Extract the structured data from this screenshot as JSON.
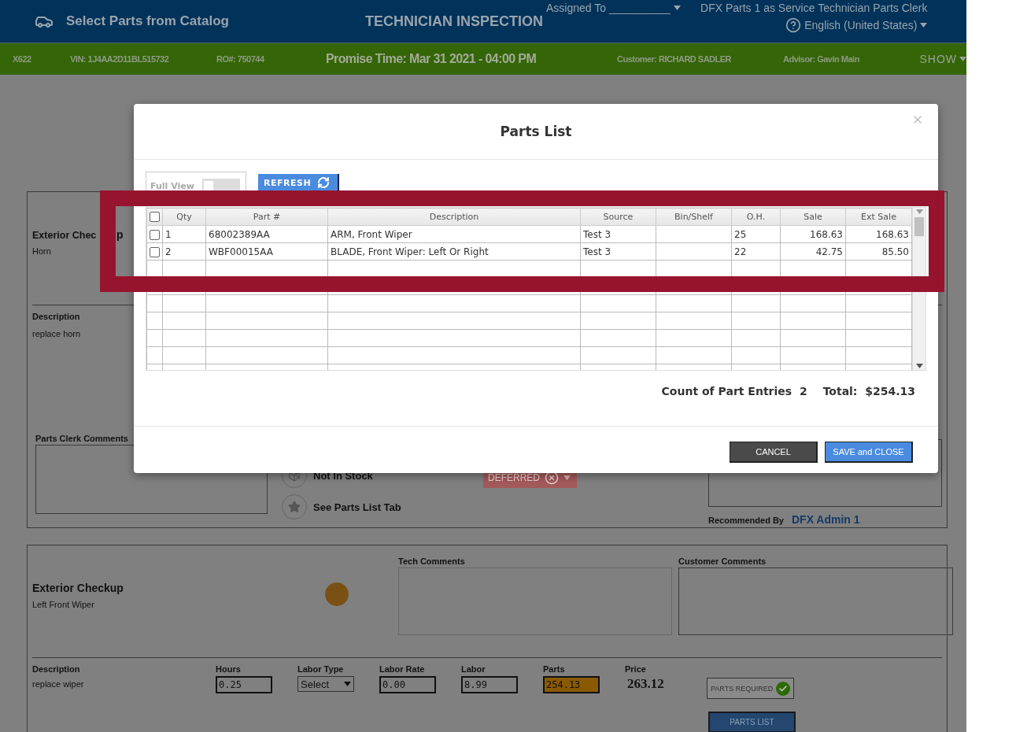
{
  "header": {
    "title": "Select Parts from Catalog",
    "page_title": "TECHNICIAN INSPECTION",
    "assigned_label": "Assigned To",
    "assigned_value": "__________",
    "user": "DFX Parts 1 as Service Technician Parts Clerk",
    "language": "English (United States)"
  },
  "vehicle_bar": {
    "unit": "X622",
    "vin": "VIN: 1J4AA2D11BL515732",
    "ro": "RO#: 750744",
    "promise_time": "Promise Time: Mar 31 2021 - 04:00 PM",
    "customer": "Customer: RICHARD SADLER",
    "advisor": "Advisor: Gavin Main",
    "show_button": "SHOW"
  },
  "inspection_items": [
    {
      "kind": "deferred",
      "category": "Exterior Chec",
      "category_tail": "p",
      "item": "Horn",
      "description_label": "Description",
      "description": "replace horn",
      "clerk_comments_label": "Parts Clerk Comments",
      "options": [
        {
          "kind": "not-in-stock",
          "label": "Not In Stock"
        },
        {
          "kind": "star",
          "label": "See Parts List Tab"
        }
      ],
      "status": "DEFERRED",
      "recommended_by_label": "Recommended By",
      "recommended_by": "DFX Admin 1"
    },
    {
      "kind": "detail",
      "category": "Exterior Checkup",
      "item": "Left Front Wiper",
      "color": "#7a5115",
      "tech_comments_label": "Tech Comments",
      "customer_comments_label": "Customer Comments",
      "fields": [
        {
          "kind": "text",
          "label": "Description",
          "value": "replace wiper"
        },
        {
          "kind": "input",
          "label": "Hours",
          "value": "0.25",
          "highlighted": false
        },
        {
          "kind": "select",
          "label": "Labor Type",
          "value": "Select"
        },
        {
          "kind": "input",
          "label": "Labor Rate",
          "value": "0.00",
          "highlighted": false
        },
        {
          "kind": "input",
          "label": "Labor",
          "value": "8.99",
          "highlighted": false
        },
        {
          "kind": "input",
          "label": "Parts",
          "value": "254.13",
          "highlighted": true
        },
        {
          "kind": "price",
          "label": "Price",
          "value": "263.12"
        }
      ],
      "parts_required": {
        "label": "PARTS REQUIRED",
        "checked": true
      },
      "parts_list_button": "PARTS LIST"
    }
  ],
  "modal": {
    "title": "Parts List",
    "full_view": {
      "label": "Full View",
      "on": false
    },
    "refresh_button": "REFRESH",
    "all_checked": false,
    "table": {
      "columns": [
        "Qty",
        "Part #",
        "Description",
        "Source",
        "Bin/Shelf",
        "O.H.",
        "Sale",
        "Ext Sale"
      ],
      "rows": [
        {
          "checked": false,
          "qty": "1",
          "part": "68002389AA",
          "description": "ARM, Front Wiper",
          "source": "Test 3",
          "oh": "25",
          "sale": "168.63",
          "ext_sale": "168.63"
        },
        {
          "checked": false,
          "qty": "2",
          "part": "WBF00015AA",
          "description": "BLADE, Front Wiper: Left Or Right",
          "source": "Test 3",
          "oh": "22",
          "sale": "42.75",
          "ext_sale": "85.50"
        }
      ]
    },
    "count_label": "Count of Part Entries",
    "count": "2",
    "total_label": "Total:",
    "total": "$254.13",
    "buttons": [
      {
        "kind": "cancel",
        "label": "CANCEL"
      },
      {
        "kind": "save",
        "label": "SAVE and CLOSE"
      }
    ]
  }
}
